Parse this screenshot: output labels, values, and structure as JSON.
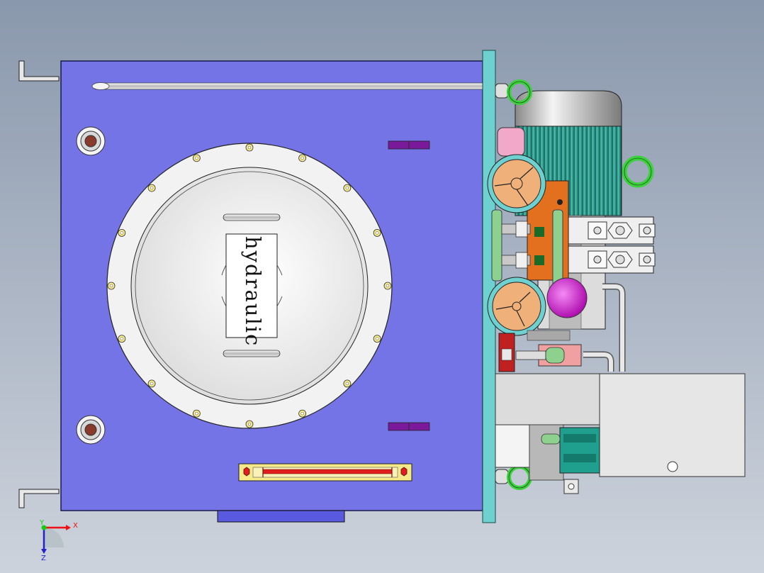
{
  "tank": {
    "label": "hydraulic"
  },
  "triad": {
    "x_label": "X",
    "y_label": "Y",
    "z_label": "Z"
  },
  "colors": {
    "background_top": "#8a98ad",
    "background_bottom": "#cdd3dc",
    "tank_body": "#7474e6",
    "cover": "#f2f2f2",
    "motor": "#2a9a8c",
    "valve_block": "#e2701e",
    "filter": "#f0b07a",
    "accent_cyan": "#6fd0d0",
    "fittings": "#8ed08e",
    "eye_bolt": "#3ad23a",
    "magenta": "#d21fd2",
    "marker": "#7a1a9a",
    "sight_glass_frame": "#f5e98a",
    "sight_glass_level": "#e01e1e"
  }
}
